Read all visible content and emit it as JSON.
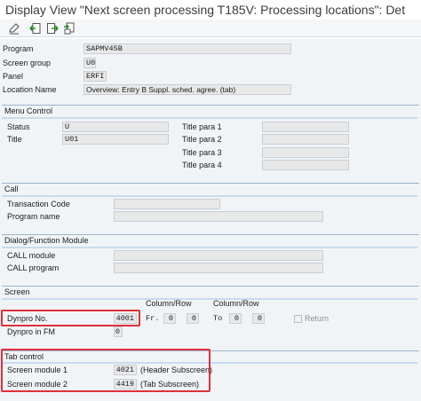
{
  "window": {
    "title": "Display View \"Next screen processing T185V: Processing locations\": Det"
  },
  "toolbar": {
    "buttons": [
      "edit-pencil-icon",
      "back-arrow-icon",
      "export-icon",
      "copy-icon"
    ]
  },
  "header": {
    "program_label": "Program",
    "program_value": "SAPMV45B",
    "screen_group_label": "Screen group",
    "screen_group_value": "U0",
    "panel_label": "Panel",
    "panel_value": "ERFI",
    "location_label": "Location Name",
    "location_value": "Overview: Entry B  Suppl. sched. agree.       (tab)"
  },
  "menu_control": {
    "title": "Menu Control",
    "status_label": "Status",
    "status_value": "U",
    "title_label": "Title",
    "title_value": "U01",
    "title_para_labels": [
      "Title para 1",
      "Title para 2",
      "Title para 3",
      "Title para 4"
    ],
    "title_para_values": [
      "",
      "",
      "",
      ""
    ]
  },
  "call": {
    "title": "Call",
    "transaction_label": "Transaction Code",
    "transaction_value": "",
    "program_label": "Program name",
    "program_value": ""
  },
  "dialog_module": {
    "title": "Dialog/Function Module",
    "call_module_label": "CALL module",
    "call_module_value": "",
    "call_program_label": "CALL program",
    "call_program_value": ""
  },
  "screen": {
    "title": "Screen",
    "column_row_label_1": "Column/Row",
    "column_row_label_2": "Column/Row",
    "dynpro_label": "Dynpro No.",
    "dynpro_value": "4001",
    "from_label": "Fr.",
    "from_col": "0",
    "from_row": "0",
    "to_label": "To",
    "to_col": "0",
    "to_row": "0",
    "return_label": "Return",
    "return_checked": false,
    "dynpro_fm_label": "Dynpro in FM",
    "dynpro_fm_value": "0"
  },
  "tab_control": {
    "title": "Tab control",
    "module1_label": "Screen module 1",
    "module1_value": "4021",
    "module1_desc": "(Header Subscreen)",
    "module2_label": "Screen module 2",
    "module2_value": "4419",
    "module2_desc": "(Tab Subscreen)"
  },
  "colors": {
    "highlight": "#e0303a",
    "section_line": "#9db4cc",
    "field_bg": "#e8e8e8",
    "panel_bg": "#f1f4f7"
  }
}
